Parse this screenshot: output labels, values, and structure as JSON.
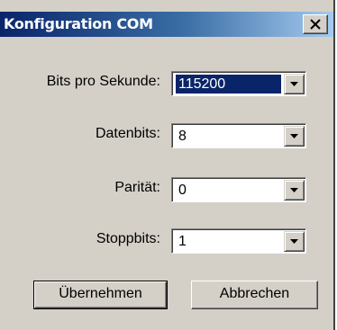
{
  "window": {
    "title": "Konfiguration COM"
  },
  "fields": {
    "baud": {
      "label": "Bits pro Sekunde:",
      "value": "115200"
    },
    "databits": {
      "label": "Datenbits:",
      "value": "8"
    },
    "parity": {
      "label": "Parität:",
      "value": "0"
    },
    "stopbits": {
      "label": "Stoppbits:",
      "value": "1"
    }
  },
  "buttons": {
    "apply": "Übernehmen",
    "cancel": "Abbrechen"
  },
  "icons": {
    "close": "close-icon",
    "dropdown": "chevron-down-icon"
  },
  "colors": {
    "title_start": "#0a246a",
    "title_end": "#a6caf0",
    "selection": "#0a246a",
    "dialog_bg": "#d4d0c8"
  }
}
